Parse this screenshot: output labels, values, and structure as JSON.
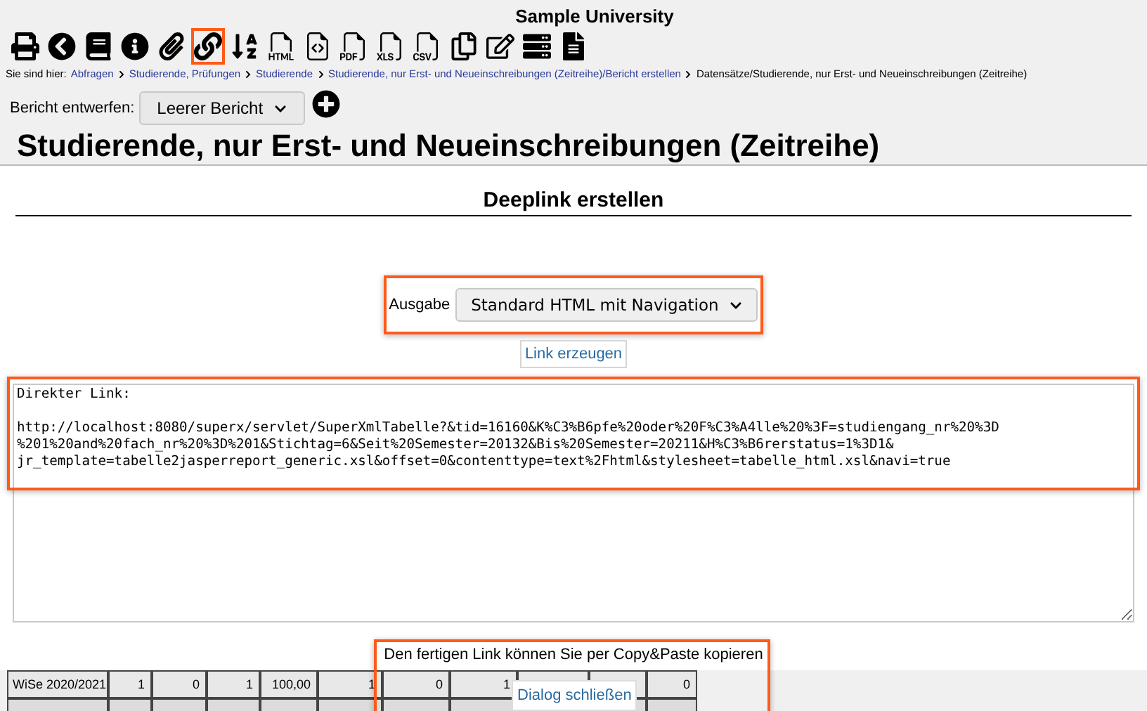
{
  "header": {
    "title": "Sample University"
  },
  "toolbar": [
    {
      "kind": "print",
      "highlighted": false
    },
    {
      "kind": "back",
      "highlighted": false
    },
    {
      "kind": "book",
      "highlighted": false
    },
    {
      "kind": "info",
      "highlighted": false
    },
    {
      "kind": "attach",
      "highlighted": false
    },
    {
      "kind": "link",
      "highlighted": true
    },
    {
      "kind": "sort",
      "highlighted": false
    },
    {
      "kind": "html",
      "highlighted": false
    },
    {
      "kind": "code",
      "highlighted": false
    },
    {
      "kind": "pdf",
      "highlighted": false
    },
    {
      "kind": "xls",
      "highlighted": false
    },
    {
      "kind": "csv",
      "highlighted": false
    },
    {
      "kind": "copy",
      "highlighted": false
    },
    {
      "kind": "edit",
      "highlighted": false
    },
    {
      "kind": "list",
      "highlighted": false
    },
    {
      "kind": "document",
      "highlighted": false
    }
  ],
  "breadcrumb": {
    "label": "Sie sind hier:",
    "links": [
      "Abfragen",
      "Studierende, Prüfungen",
      "Studierende",
      "Studierende, nur Erst- und Neueinschreibungen (Zeitreihe)/Bericht erstellen"
    ],
    "current": "Datensätze/Studierende, nur Erst- und Neueinschreibungen (Zeitreihe)"
  },
  "report": {
    "label": "Bericht entwerfen:",
    "value": "Leerer Bericht"
  },
  "page_title": "Studierende, nur Erst- und Neueinschreibungen (Zeitreihe)",
  "dialog": {
    "title": "Deeplink erstellen",
    "output": {
      "label": "Ausgabe",
      "value": "Standard HTML mit Navigation",
      "highlighted": true
    },
    "create_button": "Link erzeugen",
    "link_text": "Direkter Link:\n\nhttp://localhost:8080/superx/servlet/SuperXmlTabelle?&tid=16160&K%C3%B6pfe%20oder%20F%C3%A4lle%20%3F=studiengang_nr%20%3D\n%201%20and%20fach_nr%20%3D%201&Stichtag=6&Seit%20Semester=20132&Bis%20Semester=20211&H%C3%B6rerstatus=1%3D1&\njr_template=tabelle2jasperreport_generic.xsl&offset=0&contenttype=text%2Fhtml&stylesheet=tabelle_html.xsl&navi=true",
    "link_highlighted": true,
    "hint": "Den fertigen Link können Sie per Copy&Paste kopieren",
    "hint_highlighted": true,
    "close_button": "Dialog schließen"
  },
  "table": {
    "rows": [
      [
        "WiSe 2020/2021",
        "1",
        "0",
        "1",
        "100,00",
        "1",
        "0",
        "1",
        null,
        null,
        "0"
      ]
    ]
  }
}
